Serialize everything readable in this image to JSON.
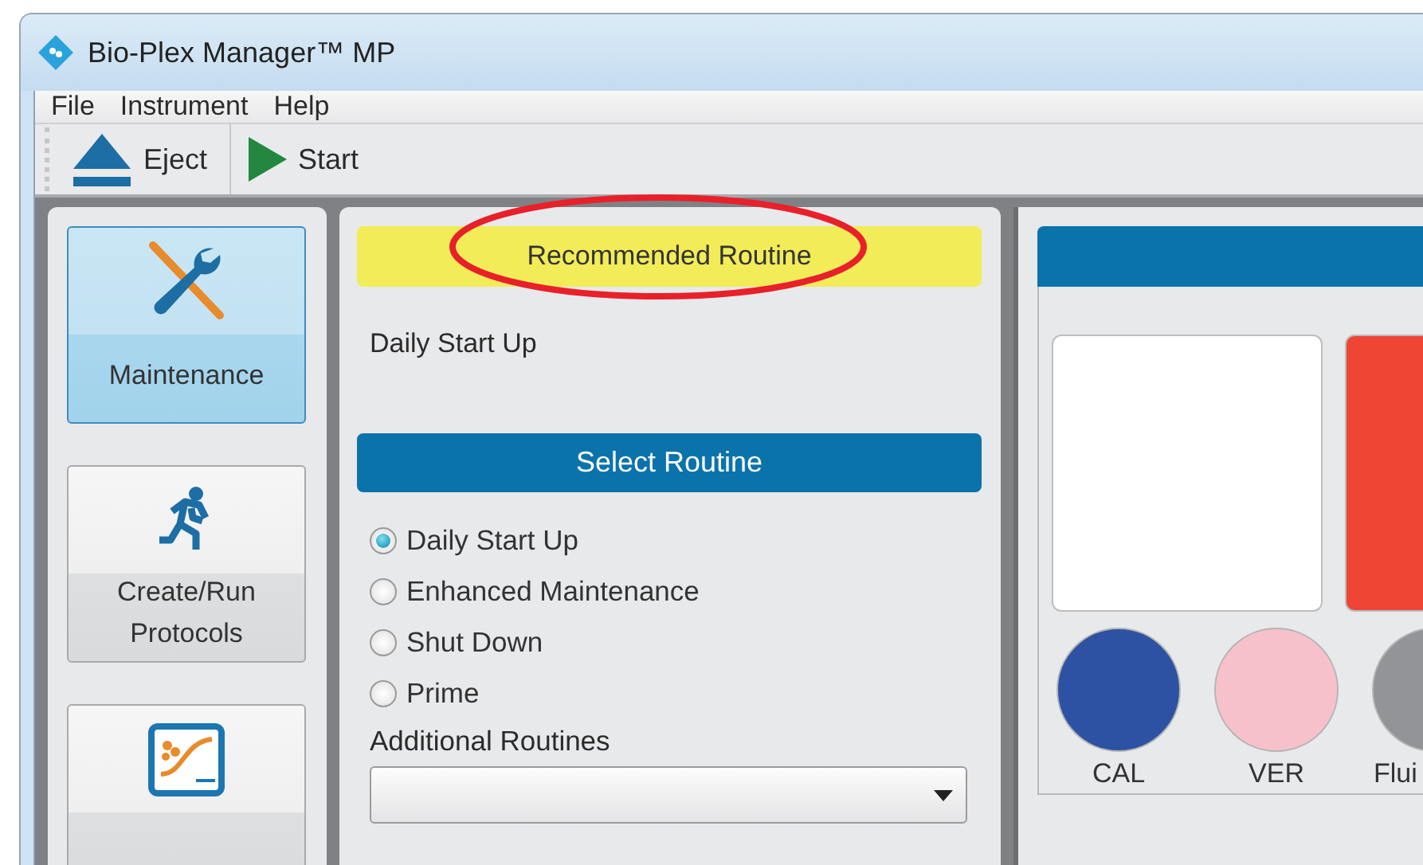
{
  "window": {
    "title": "Bio-Plex Manager™ MP"
  },
  "menu": [
    "File",
    "Instrument",
    "Help"
  ],
  "toolbar": [
    {
      "kind": "eject",
      "label": "Eject"
    },
    {
      "kind": "start",
      "label": "Start"
    }
  ],
  "nav": [
    {
      "kind": "maintenance",
      "label": "Maintenance",
      "selected": true
    },
    {
      "kind": "protocols",
      "label": "Create/Run Protocols",
      "selected": false
    },
    {
      "kind": "analysis",
      "selected": false
    }
  ],
  "recommended": {
    "heading": "Recommended Routine",
    "routine": "Daily Start Up",
    "annotation": {
      "kind": "ellipse",
      "color": "#e8202a"
    }
  },
  "select_routine": {
    "heading": "Select Routine",
    "options": [
      {
        "label": "Daily Start Up",
        "selected": true
      },
      {
        "label": "Enhanced Maintenance",
        "selected": false
      },
      {
        "label": "Shut Down",
        "selected": false
      },
      {
        "label": "Prime",
        "selected": false
      }
    ],
    "additional_label": "Additional Routines"
  },
  "reagents": {
    "tiles": [
      {
        "color": "#ffffff"
      },
      {
        "color": "#ee4535"
      }
    ],
    "bottles": [
      {
        "label": "CAL",
        "color": "#2d52a3"
      },
      {
        "label": "VER",
        "color": "#f7c1cc"
      },
      {
        "label": "Flui",
        "color": "#939498"
      }
    ]
  }
}
